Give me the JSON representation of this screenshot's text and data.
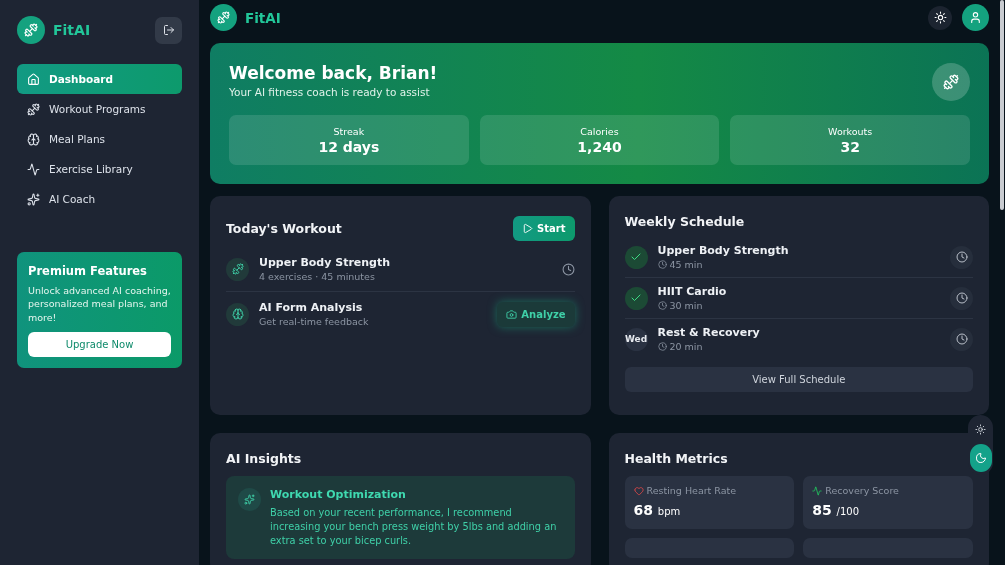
{
  "sidebar": {
    "brand": "FitAI",
    "nav": [
      {
        "label": "Dashboard",
        "selected": true
      },
      {
        "label": "Workout Programs",
        "selected": false
      },
      {
        "label": "Meal Plans",
        "selected": false
      },
      {
        "label": "Exercise Library",
        "selected": false
      },
      {
        "label": "AI Coach",
        "selected": false
      }
    ],
    "promo": {
      "title": "Premium Features",
      "text": "Unlock advanced AI coaching, personalized meal plans, and more!",
      "button": "Upgrade Now"
    }
  },
  "header": {
    "brand": "FitAI"
  },
  "hero": {
    "title": "Welcome back, Brian!",
    "subtitle": "Your AI fitness coach is ready to assist",
    "stats": [
      {
        "label": "Streak",
        "value": "12 days"
      },
      {
        "label": "Calories",
        "value": "1,240"
      },
      {
        "label": "Workouts",
        "value": "32"
      }
    ]
  },
  "todays_workout": {
    "title": "Today's Workout",
    "start_button": "Start",
    "items": [
      {
        "kind": "workout",
        "title": "Upper Body Strength",
        "subtitle": "4 exercises · 45 minutes"
      },
      {
        "kind": "analysis",
        "title": "AI Form Analysis",
        "subtitle": "Get real-time feedback",
        "button": "Analyze"
      }
    ]
  },
  "weekly_schedule": {
    "title": "Weekly Schedule",
    "items": [
      {
        "title": "Upper Body Strength",
        "duration": "45 min",
        "done": true
      },
      {
        "title": "HIIT Cardio",
        "duration": "30 min",
        "done": true
      },
      {
        "title": "Rest & Recovery",
        "duration": "20 min",
        "done": false,
        "day": "Wed"
      }
    ],
    "button": "View Full Schedule"
  },
  "ai_insights": {
    "title": "AI Insights",
    "insights": [
      {
        "title": "Workout Optimization",
        "text": "Based on your recent performance, I recommend increasing your bench press weight by 5lbs and adding an extra set to your bicep curls."
      }
    ]
  },
  "health_metrics": {
    "title": "Health Metrics",
    "metrics": [
      {
        "kind": "heart",
        "label": "Resting Heart Rate",
        "value": "68",
        "unit": "bpm"
      },
      {
        "kind": "recovery",
        "label": "Recovery Score",
        "value": "85",
        "unit": "/100"
      }
    ]
  },
  "theme_toggle": {
    "options": [
      {
        "kind": "light",
        "selected": false
      },
      {
        "kind": "dark",
        "selected": true
      }
    ]
  }
}
